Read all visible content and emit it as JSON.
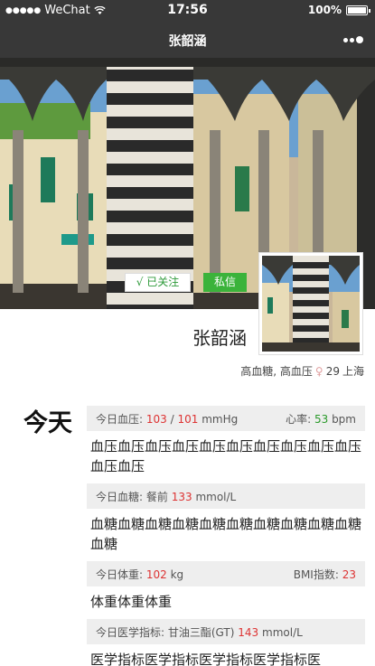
{
  "status_bar": {
    "signal": "●●●●●",
    "carrier": "WeChat",
    "time": "17:56",
    "battery": "100%"
  },
  "nav": {
    "title": "张韶涵"
  },
  "profile": {
    "follow_label": "√ 已关注",
    "message_label": "私信",
    "name": "张韶涵",
    "conditions": "高血糖, 高血压",
    "gender_symbol": "♀",
    "age": "29",
    "city": "上海"
  },
  "today": {
    "label": "今天",
    "bp": {
      "label": "今日血压:",
      "systolic": "103",
      "separator": "/",
      "diastolic": "101",
      "unit": "mmHg",
      "hr_label": "心率:",
      "hr_value": "53",
      "hr_unit": "bpm",
      "note": "血压血压血压血压血压血压血压血压血压血压血压血压"
    },
    "glucose": {
      "label": "今日血糖:",
      "timing": "餐前",
      "value": "133",
      "unit": "mmol/L",
      "note": "血糖血糖血糖血糖血糖血糖血糖血糖血糖血糖血糖"
    },
    "weight": {
      "label": "今日体重:",
      "value": "102",
      "unit": "kg",
      "bmi_label": "BMI指数:",
      "bmi_value": "23",
      "note": "体重体重体重"
    },
    "medical": {
      "label": "今日医学指标:",
      "indicator": "甘油三酯(GT)",
      "value": "143",
      "unit": "mmol/L",
      "note": "医学指标医学指标医学指标医学指标医"
    }
  },
  "colors": {
    "bar_bg": "#383838",
    "accent_green": "#3bb33b",
    "value_red": "#d33333",
    "value_green": "#2a9a2a"
  }
}
